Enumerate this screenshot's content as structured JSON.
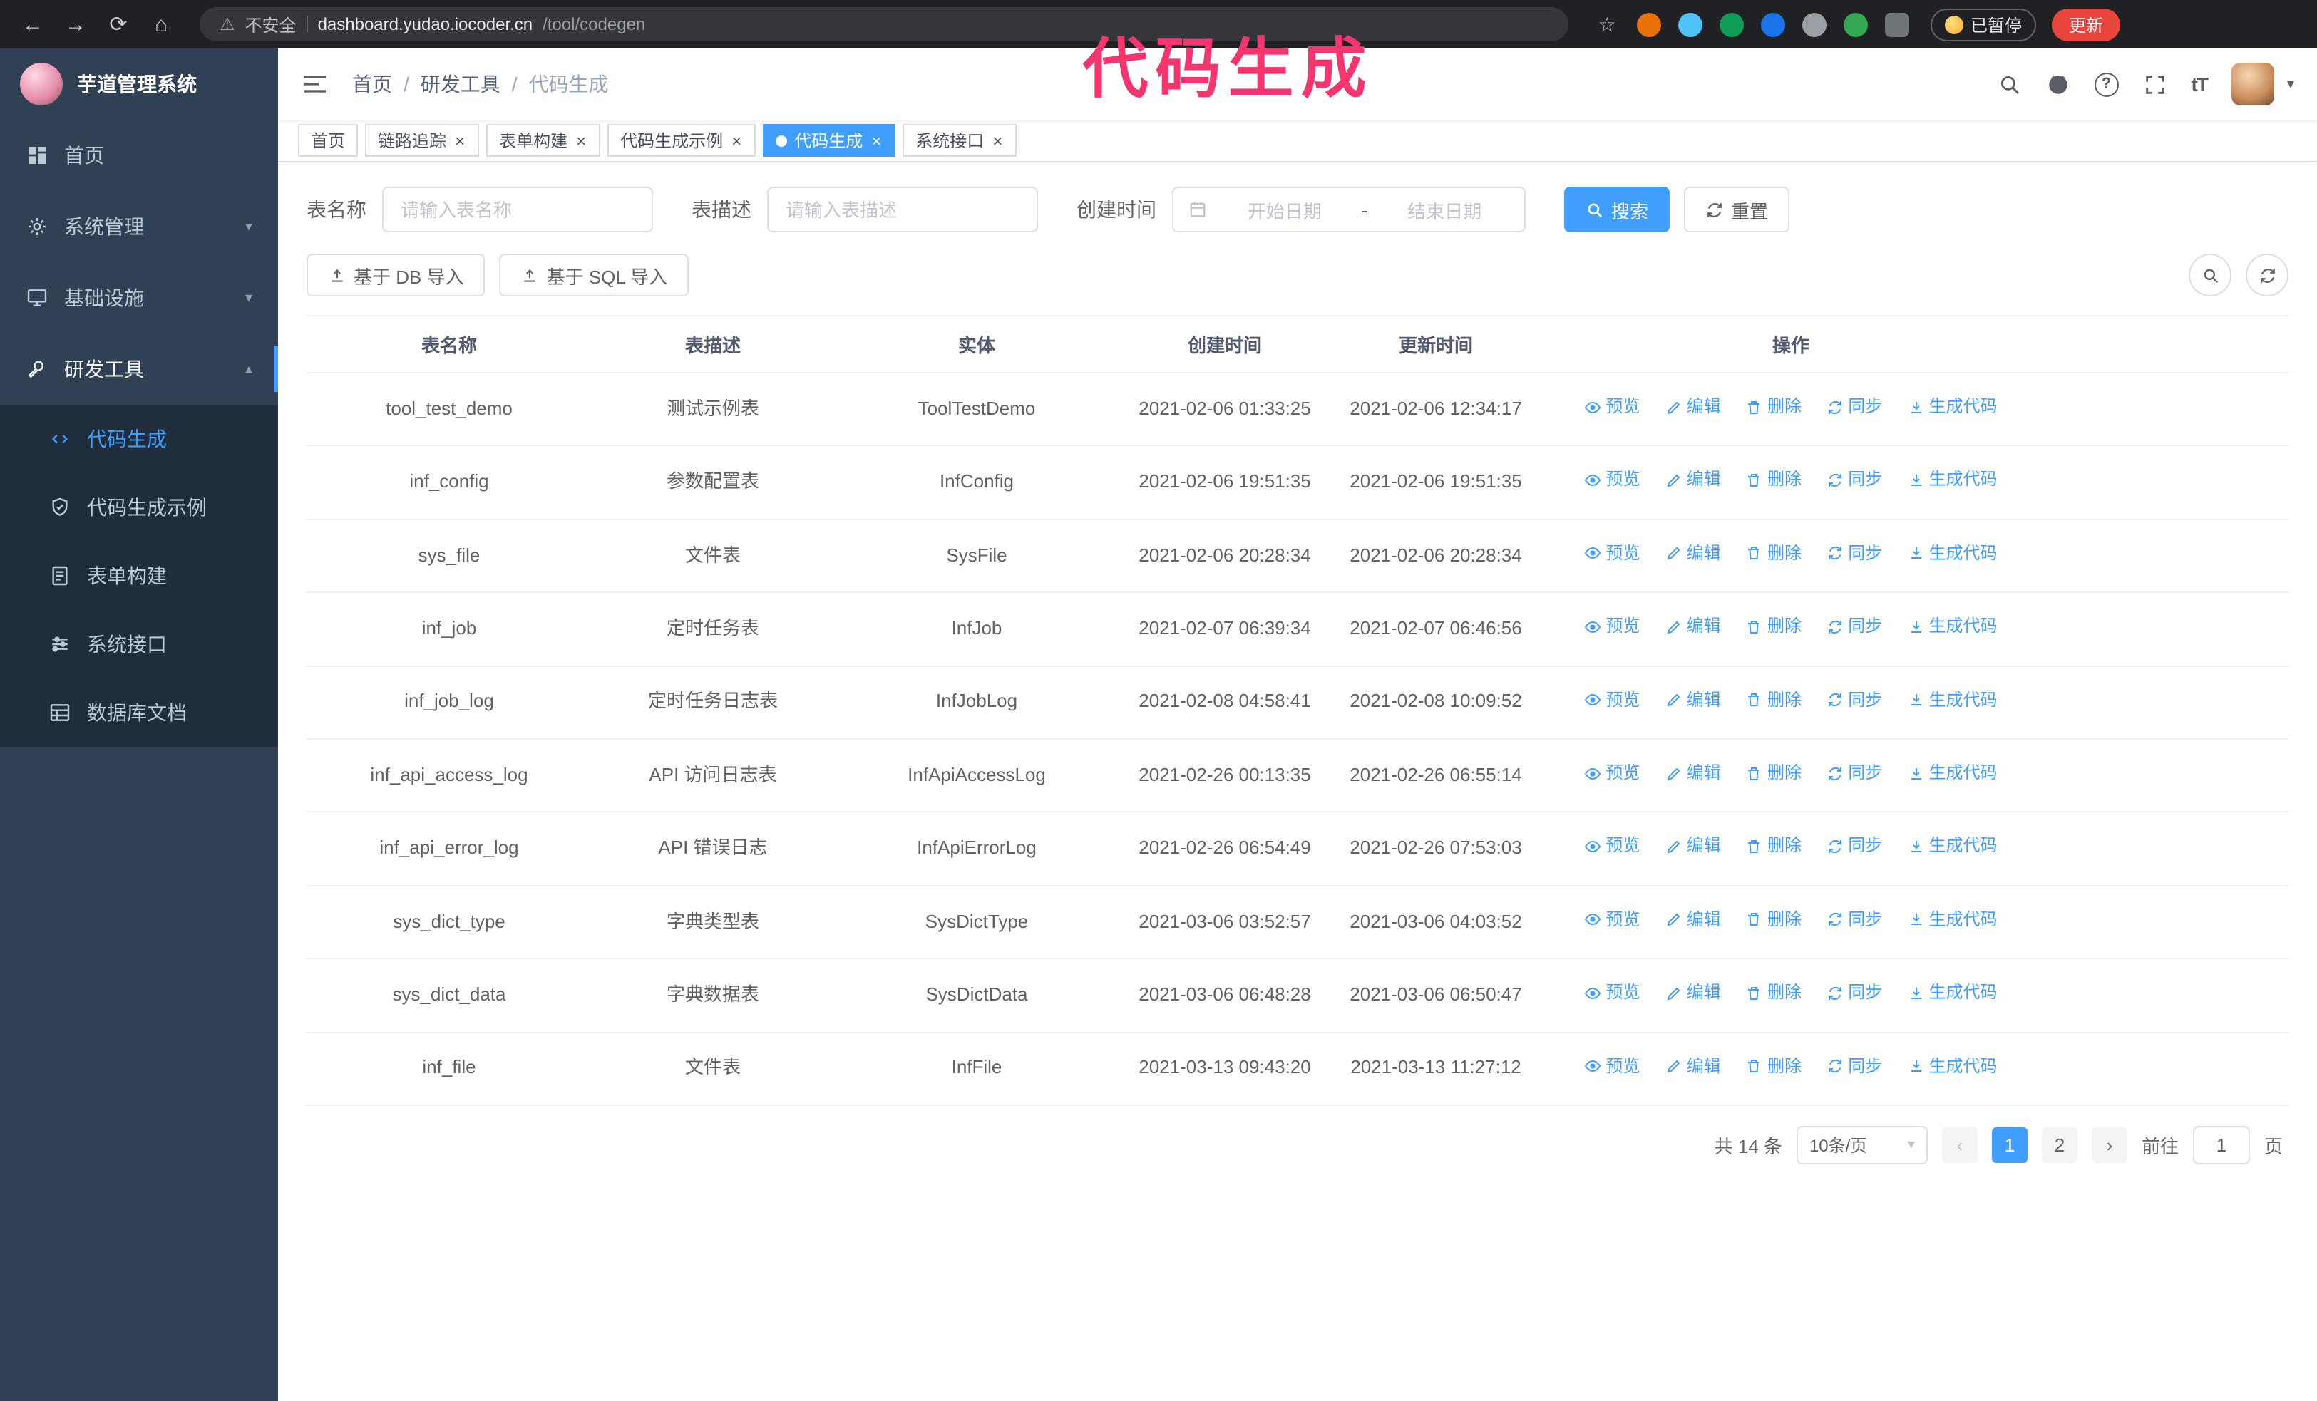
{
  "colors": {
    "accent": "#409eff",
    "annotation": "#f5356e",
    "sidebar": "#304156",
    "submenu": "#1f2d3d",
    "update": "#e8453c"
  },
  "icons": {
    "back": "←",
    "forward": "→",
    "reload": "⟳",
    "home": "⌂",
    "warning": "⚠",
    "star": "☆",
    "close": "×",
    "separator": "/",
    "chevron_down": "▾",
    "chevron_up": "▴",
    "caret_down": "▾",
    "question": "?",
    "prev": "‹",
    "next": "›"
  },
  "annotation": {
    "text": "代码生成"
  },
  "browser": {
    "security_label": "不安全",
    "url_host": "dashboard.yudao.iocoder.cn",
    "url_path": "/tool/codegen",
    "paused_label": "已暂停",
    "update_label": "更新"
  },
  "sidebar": {
    "logo_title": "芋道管理系统",
    "items": [
      {
        "label": "首页"
      },
      {
        "label": "系统管理"
      },
      {
        "label": "基础设施"
      },
      {
        "label": "研发工具"
      }
    ],
    "subitems": [
      {
        "label": "代码生成"
      },
      {
        "label": "代码生成示例"
      },
      {
        "label": "表单构建"
      },
      {
        "label": "系统接口"
      },
      {
        "label": "数据库文档"
      }
    ]
  },
  "header": {
    "breadcrumb": {
      "home": "首页",
      "section": "研发工具",
      "current": "代码生成"
    },
    "fontsize_icon": "tT"
  },
  "tabs": [
    {
      "label": "首页"
    },
    {
      "label": "链路追踪"
    },
    {
      "label": "表单构建"
    },
    {
      "label": "代码生成示例"
    },
    {
      "label": "代码生成"
    },
    {
      "label": "系统接口"
    }
  ],
  "filters": {
    "table_name_label": "表名称",
    "table_name_placeholder": "请输入表名称",
    "table_desc_label": "表描述",
    "table_desc_placeholder": "请输入表描述",
    "create_time_label": "创建时间",
    "date_start_placeholder": "开始日期",
    "date_separator": "-",
    "date_end_placeholder": "结束日期",
    "search_button": "搜索",
    "reset_button": "重置"
  },
  "toolbar": {
    "import_db": "基于 DB 导入",
    "import_sql": "基于 SQL 导入"
  },
  "table": {
    "columns": [
      "表名称",
      "表描述",
      "实体",
      "创建时间",
      "更新时间",
      "操作"
    ],
    "actions": [
      "预览",
      "编辑",
      "删除",
      "同步",
      "生成代码"
    ],
    "rows": [
      {
        "name": "tool_test_demo",
        "desc": "测试示例表",
        "entity": "ToolTestDemo",
        "created": "2021-02-06 01:33:25",
        "updated": "2021-02-06 12:34:17"
      },
      {
        "name": "inf_config",
        "desc": "参数配置表",
        "entity": "InfConfig",
        "created": "2021-02-06 19:51:35",
        "updated": "2021-02-06 19:51:35"
      },
      {
        "name": "sys_file",
        "desc": "文件表",
        "entity": "SysFile",
        "created": "2021-02-06 20:28:34",
        "updated": "2021-02-06 20:28:34"
      },
      {
        "name": "inf_job",
        "desc": "定时任务表",
        "entity": "InfJob",
        "created": "2021-02-07 06:39:34",
        "updated": "2021-02-07 06:46:56"
      },
      {
        "name": "inf_job_log",
        "desc": "定时任务日志表",
        "entity": "InfJobLog",
        "created": "2021-02-08 04:58:41",
        "updated": "2021-02-08 10:09:52"
      },
      {
        "name": "inf_api_access_log",
        "desc": "API 访问日志表",
        "entity": "InfApiAccessLog",
        "created": "2021-02-26 00:13:35",
        "updated": "2021-02-26 06:55:14"
      },
      {
        "name": "inf_api_error_log",
        "desc": "API 错误日志",
        "entity": "InfApiErrorLog",
        "created": "2021-02-26 06:54:49",
        "updated": "2021-02-26 07:53:03"
      },
      {
        "name": "sys_dict_type",
        "desc": "字典类型表",
        "entity": "SysDictType",
        "created": "2021-03-06 03:52:57",
        "updated": "2021-03-06 04:03:52"
      },
      {
        "name": "sys_dict_data",
        "desc": "字典数据表",
        "entity": "SysDictData",
        "created": "2021-03-06 06:48:28",
        "updated": "2021-03-06 06:50:47"
      },
      {
        "name": "inf_file",
        "desc": "文件表",
        "entity": "InfFile",
        "created": "2021-03-13 09:43:20",
        "updated": "2021-03-13 11:27:12"
      }
    ]
  },
  "pagination": {
    "total": "共 14 条",
    "page_size": "10条/页",
    "pages": [
      "1",
      "2"
    ],
    "goto_label": "前往",
    "goto_value": "1",
    "goto_unit": "页"
  }
}
